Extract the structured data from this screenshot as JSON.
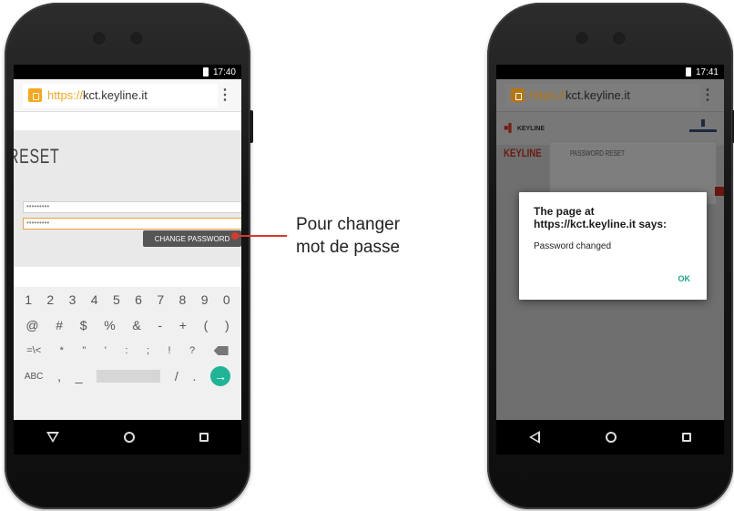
{
  "left_phone": {
    "status_time": "17:40",
    "url_scheme": "https://",
    "url_host": "kct.keyline.it",
    "menu_icon": "more-vert-icon",
    "page_heading": "RESET",
    "password_field_1": "•••••••••",
    "password_field_2": "•••••••••",
    "change_button": "CHANGE PASSWORD",
    "keyboard": {
      "row1": [
        "1",
        "2",
        "3",
        "4",
        "5",
        "6",
        "7",
        "8",
        "9",
        "0"
      ],
      "row2": [
        "@",
        "#",
        "$",
        "%",
        "&",
        "-",
        "+",
        "(",
        ")"
      ],
      "row3": [
        "=\\<",
        "*",
        "\"",
        "'",
        ":",
        ";",
        "!",
        "?"
      ],
      "row4_left": "ABC",
      "row4_keys": [
        ",",
        "_",
        "/",
        "."
      ]
    }
  },
  "callout": {
    "line1": "Pour changer",
    "line2": "mot de passe",
    "color": "#d63a2f"
  },
  "right_phone": {
    "status_time": "17:41",
    "url_scheme": "https://",
    "url_host": "kct.keyline.it",
    "logo_text": "KEYLINE",
    "brand_text": "KEYLINE",
    "panel_title": "PASSWORD RESET",
    "dialog": {
      "title": "The page at https://kct.keyline.it says:",
      "message": "Password changed",
      "ok": "OK"
    }
  },
  "colors": {
    "accent_orange": "#f6a81e",
    "ok_green": "#1fa58b",
    "go_key": "#1fb495"
  }
}
